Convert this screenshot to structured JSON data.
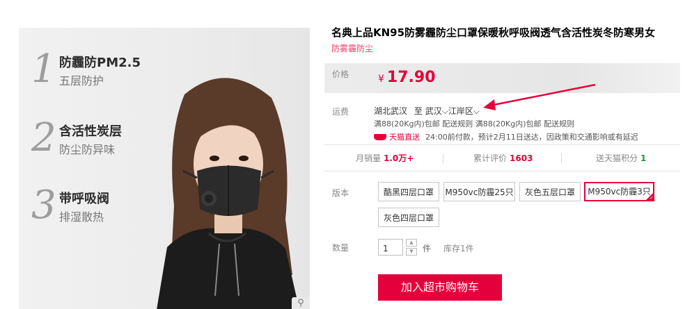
{
  "promo": {
    "features": [
      {
        "num": "1",
        "title": "防霾防PM2.5",
        "sub": "五层防护"
      },
      {
        "num": "2",
        "title": "含活性炭层",
        "sub": "防尘防异味"
      },
      {
        "num": "3",
        "title": "带呼吸阀",
        "sub": "排湿散热"
      }
    ],
    "zoom_icon": "magnifier-icon"
  },
  "product": {
    "title": "名典上品KN95防雾霾防尘口罩保暖秋呼吸阀透气含活性炭冬防寒男女",
    "subtitle": "防雾霾防尘"
  },
  "price": {
    "label": "价格",
    "currency": "¥",
    "value": "17.90"
  },
  "shipping": {
    "label": "运费",
    "from": "湖北武汉",
    "to_word": "至",
    "city": "武汉",
    "district": "江岸区",
    "rule_line": "满88(20Kg内)包邮 配送规则 满88(20Kg内)包邮 配送规则",
    "tmall_label": "天猫直送",
    "delivery_note": "24:00前付款，预计2月11日送达，因政策和交通影响或有延迟"
  },
  "stats": {
    "monthly_label": "月销量",
    "monthly_value": "1.0万+",
    "reviews_label": "累计评价",
    "reviews_value": "1603",
    "points_label": "送天猫积分",
    "points_value": "1"
  },
  "version": {
    "label": "版本",
    "options": [
      "酷黑四层口罩",
      "M950vc防霾25只",
      "灰色五层口罩",
      "M950vc防霾3只",
      "灰色四层口罩"
    ],
    "selected": "M950vc防霾3只"
  },
  "quantity": {
    "label": "数量",
    "value": "1",
    "unit": "件",
    "stock": "库存1件"
  },
  "cart_button": "加入超市购物车",
  "colors": {
    "accent": "#e4003a",
    "subtitle": "#ee3d66",
    "green": "#20962f"
  }
}
